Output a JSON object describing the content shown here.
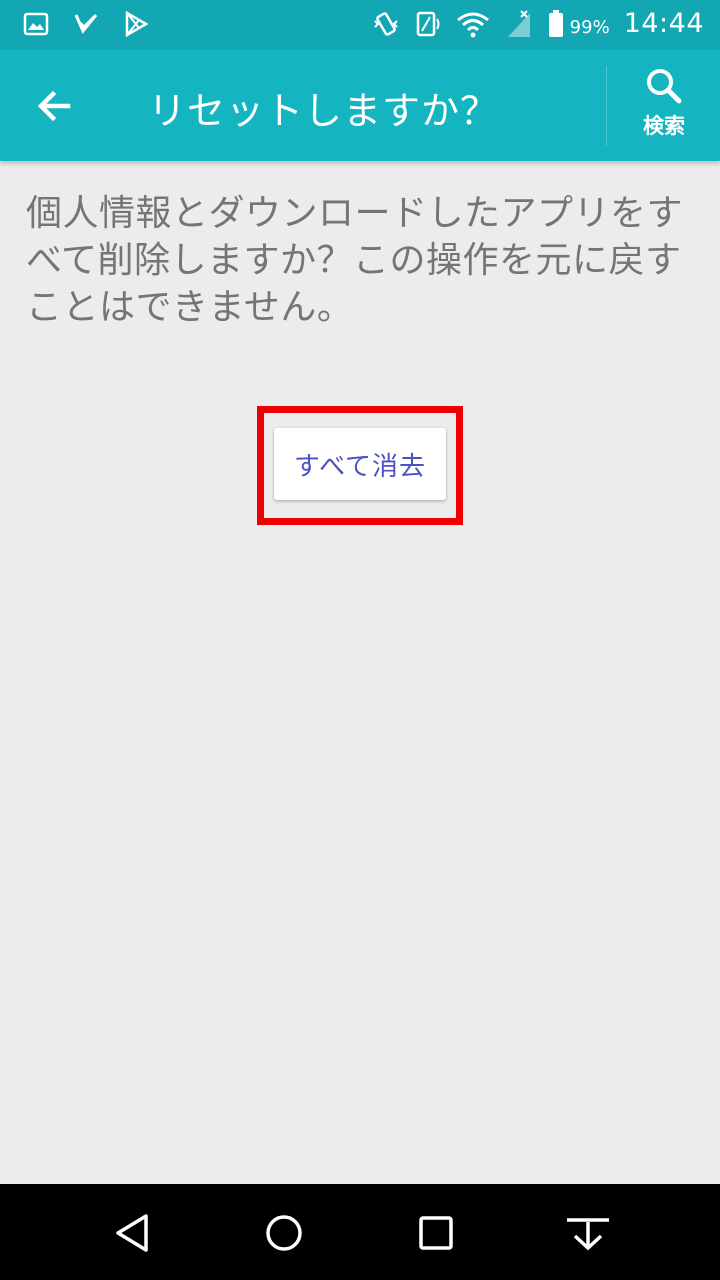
{
  "status_bar": {
    "battery_percent": "99%",
    "time": "14:44",
    "icons": [
      "gallery-icon",
      "check-icon",
      "play-store-icon",
      "vibrate-icon",
      "nfc-icon",
      "wifi-icon",
      "signal-icon",
      "battery-icon"
    ]
  },
  "toolbar": {
    "title": "リセットしますか？",
    "search_label": "検索"
  },
  "content": {
    "description": "個人情報とダウンロードしたアプリをすべて削除しますか？この操作を元に戻すことはできません。",
    "erase_button_label": "すべて消去"
  },
  "colors": {
    "status_bar": "#12a7b3",
    "toolbar": "#14b4c0",
    "background": "#ececec",
    "highlight": "#ef0000",
    "button_text": "#4c51c4"
  },
  "nav_bar": {
    "icons": [
      "back-icon",
      "home-icon",
      "recents-icon",
      "notification-pull-icon"
    ]
  }
}
